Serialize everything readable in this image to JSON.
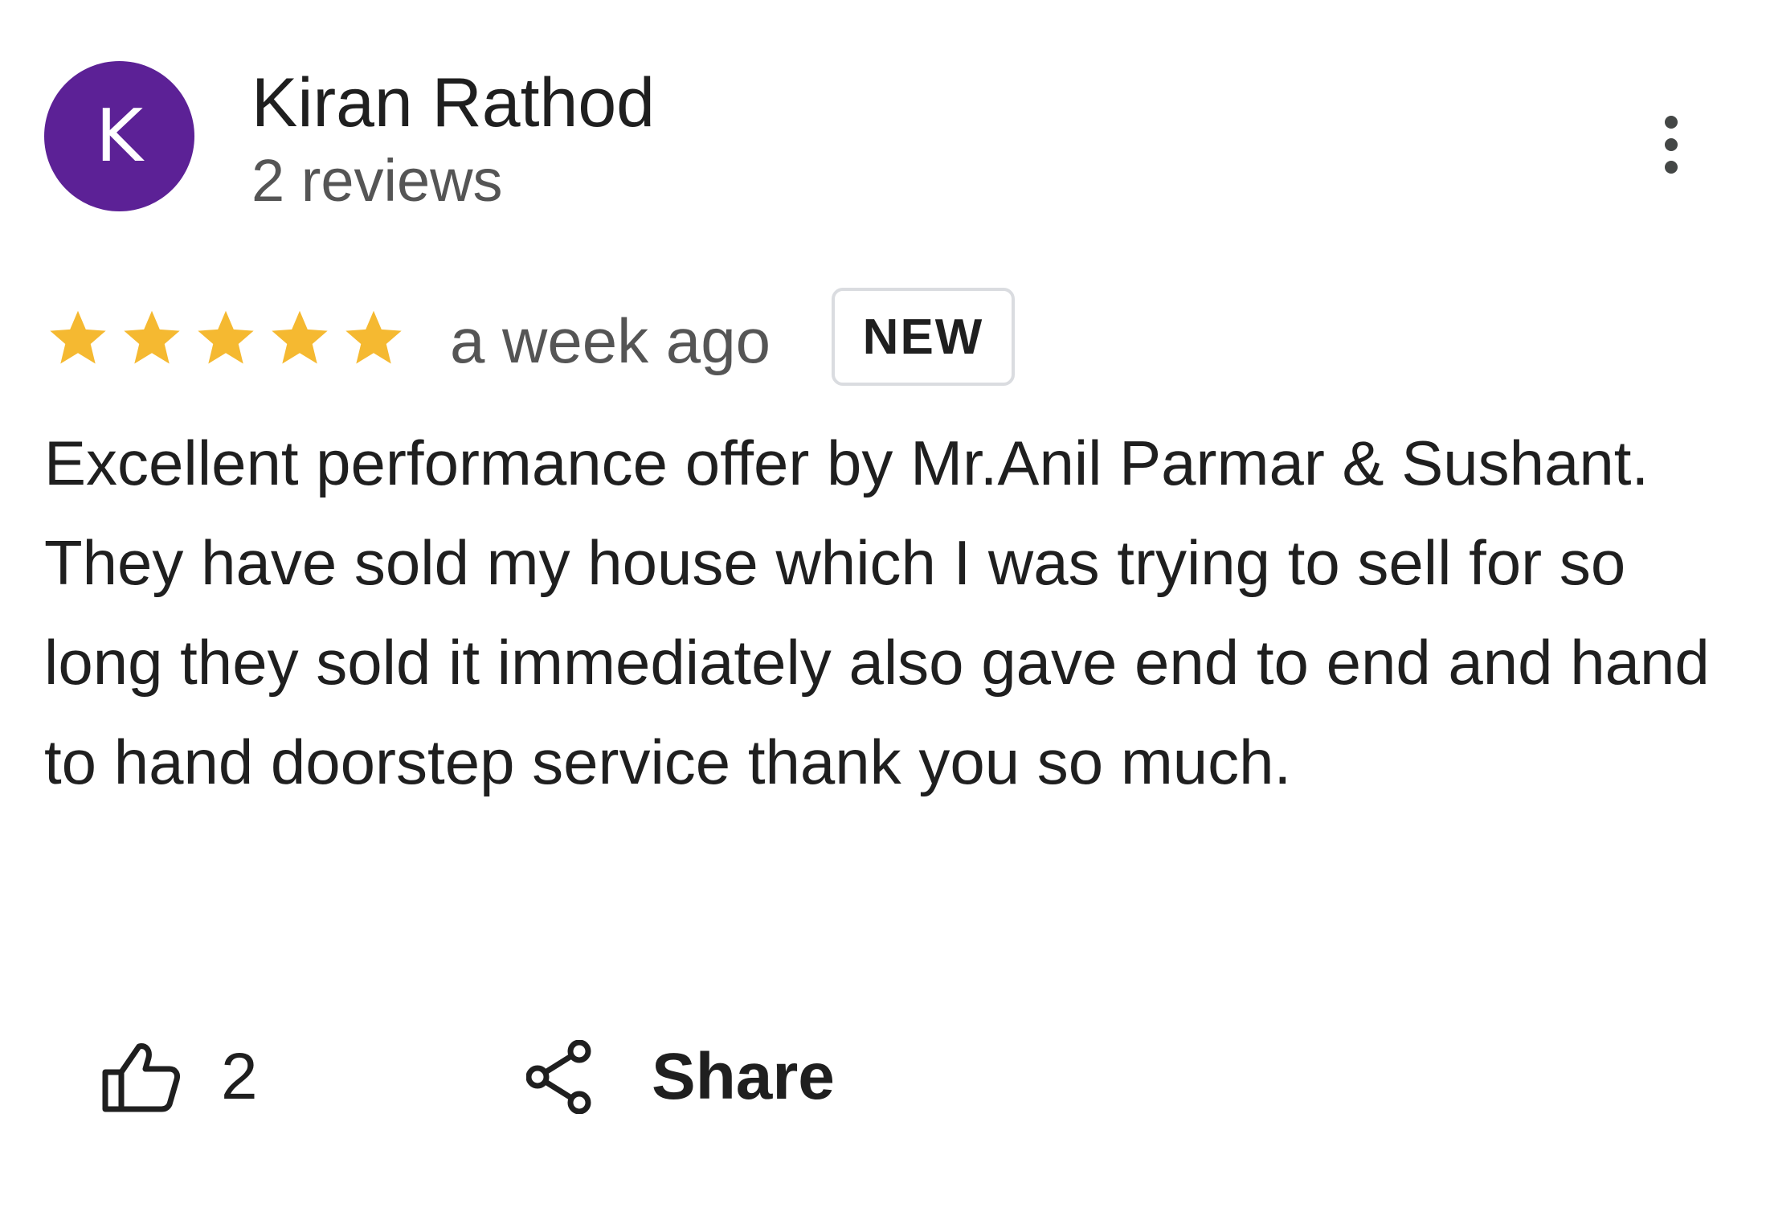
{
  "author": {
    "initial": "K",
    "name": "Kiran Rathod",
    "meta": "2 reviews",
    "avatar_color": "#5c2196"
  },
  "menu": {
    "icon": "more-vertical-icon"
  },
  "review": {
    "rating": 5,
    "max_rating": 5,
    "star_color": "#f5b931",
    "date": "a week ago",
    "badge": "NEW",
    "text": "Excellent performance offer by Mr.Anil Parmar & Sushant. They have sold my house which I was trying to sell for so long they sold it immediately also gave end to end and hand to hand doorstep service thank you so much."
  },
  "actions": {
    "like_icon": "thumbs-up-icon",
    "like_count": "2",
    "share_icon": "share-icon",
    "share_label": "Share"
  }
}
